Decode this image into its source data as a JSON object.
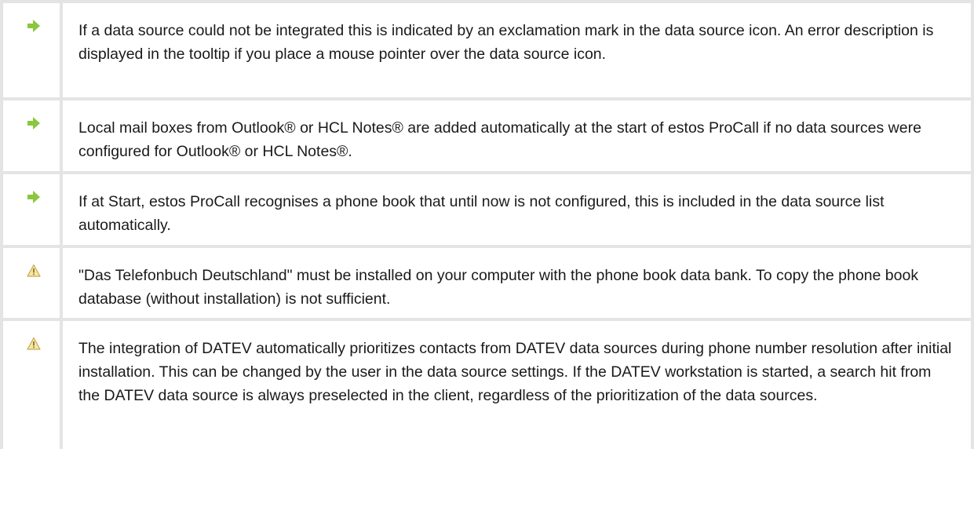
{
  "notes": [
    {
      "icon": "arrow-right-icon",
      "text": "If a data source could not be integrated this is indicated by an exclamation mark in the data source icon. An error description is displayed in the tooltip if you place a mouse pointer over the data source icon."
    },
    {
      "icon": "arrow-right-icon",
      "text": "Local mail boxes from Outlook® or HCL Notes® are added automatically at the start of estos ProCall if no data sources were configured for Outlook® or HCL Notes®."
    },
    {
      "icon": "arrow-right-icon",
      "text": "If at Start, estos ProCall recognises a phone book that until now is not configured, this is included in the data source list automatically."
    },
    {
      "icon": "warning-icon",
      "text": "\"Das Telefonbuch Deutschland\" must be installed on your computer with the phone book data bank. To copy the phone book database (without installation) is not sufficient."
    },
    {
      "icon": "warning-icon",
      "text": "The integration of DATEV automatically prioritizes contacts from DATEV data sources during phone number resolution after initial installation. This can be changed by the user in the data source settings. If the DATEV workstation is started, a search hit from the DATEV data source is always preselected in the client, regardless of the prioritization of the data sources."
    }
  ],
  "colors": {
    "arrow": "#8cc63f",
    "warning_fill": "#f5e6a8",
    "warning_stroke": "#c8a94a",
    "border": "#e4e4e4",
    "text": "#1a1a1a"
  }
}
